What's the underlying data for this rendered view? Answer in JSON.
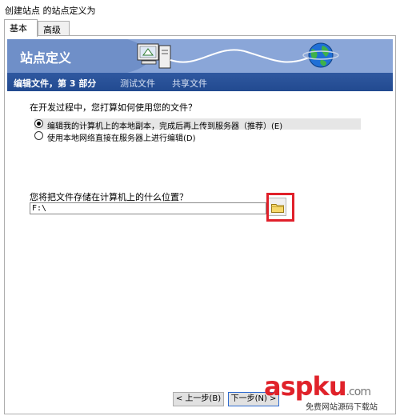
{
  "window": {
    "title": "创建站点 的站点定义为"
  },
  "tabs": [
    {
      "label": "基本",
      "active": true
    },
    {
      "label": "高级",
      "active": false
    }
  ],
  "banner": {
    "title": "站点定义",
    "icons": [
      "computer-server-icon",
      "globe-icon"
    ]
  },
  "steps": [
    {
      "label": "编辑文件，第 3 部分",
      "active": true
    },
    {
      "label": "测试文件",
      "active": false
    },
    {
      "label": "共享文件",
      "active": false
    }
  ],
  "question1": "在开发过程中，您打算如何使用您的文件？",
  "options": [
    {
      "label": "编辑我的计算机上的本地副本，完成后再上传到服务器（推荐）(E)",
      "selected": true
    },
    {
      "label": "使用本地网络直接在服务器上进行编辑(D)",
      "selected": false
    }
  ],
  "question2": "您将把文件存储在计算机上的什么位置？",
  "path": {
    "value": "F:\\"
  },
  "browse": {
    "icon": "folder-icon"
  },
  "buttons": {
    "prev": "< 上一步(B)",
    "next": "下一步(N) >"
  },
  "watermark": {
    "main": "aspku",
    "suffix": ".com",
    "sub": "免费网站源码下载站"
  },
  "colors": {
    "banner": "#6f8fc8",
    "step_bar": "#224a90",
    "highlight": "#e0202a",
    "watermark": "#e0222a"
  }
}
